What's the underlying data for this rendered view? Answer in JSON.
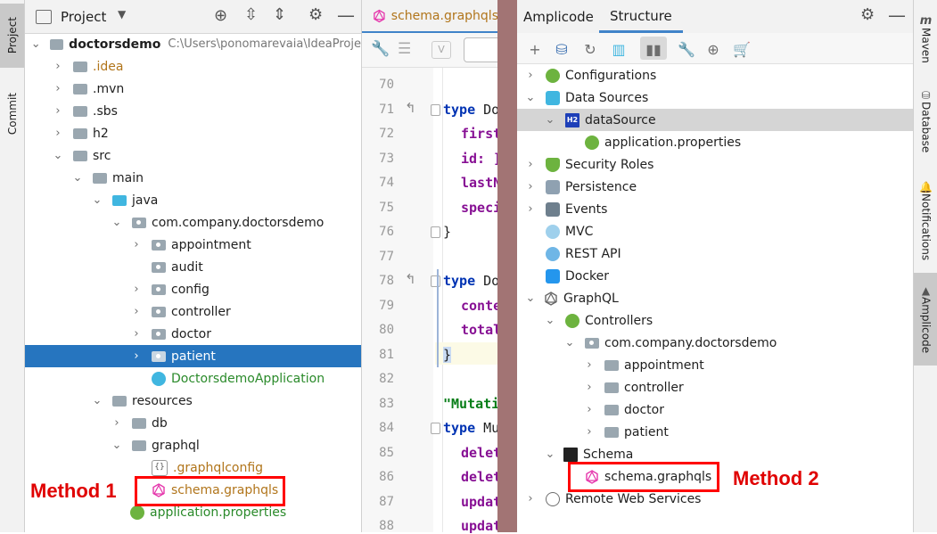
{
  "left_stripe": {
    "project": "Project",
    "commit": "Commit"
  },
  "right_stripe": {
    "maven": "Maven",
    "database": "Database",
    "notifications": "Notifications",
    "amplicode": "Amplicode"
  },
  "project_panel": {
    "title": "Project",
    "root": {
      "name": "doctorsdemo",
      "path": "C:\\Users\\ponomarevaia\\IdeaProje"
    },
    "items": [
      ".idea",
      ".mvn",
      ".sbs",
      "h2",
      "src",
      "main",
      "java",
      "com.company.doctorsdemo",
      "appointment",
      "audit",
      "config",
      "controller",
      "doctor",
      "patient",
      "DoctorsdemoApplication",
      "resources",
      "db",
      "graphql",
      ".graphqlconfig",
      "schema.graphqls",
      "application.properties"
    ]
  },
  "editor": {
    "tab": "schema.graphqls",
    "lines": [
      "70",
      "71",
      "72",
      "73",
      "74",
      "75",
      "76",
      "77",
      "78",
      "79",
      "80",
      "81",
      "82",
      "83",
      "84",
      "85",
      "86",
      "87",
      "88"
    ],
    "code": {
      "l71": "type",
      "l71b": "Do",
      "l72": "first",
      "l73": "id: ]",
      "l74": "lastN",
      "l75": "speci",
      "l76": "}",
      "l78": "type",
      "l78b": "Do",
      "l79": "conte",
      "l80": "total",
      "l81": "}",
      "l83": "\"Mutati",
      "l84": "type",
      "l84b": "Mu",
      "l85": "delet",
      "l86": "delet",
      "l87": "updat",
      "l88": "updat"
    }
  },
  "structure_panel": {
    "tabs": [
      "Amplicode",
      "Structure"
    ],
    "items": [
      "Configurations",
      "Data Sources",
      "dataSource",
      "application.properties",
      "Security Roles",
      "Persistence",
      "Events",
      "MVC",
      "REST API",
      "Docker",
      "GraphQL",
      "Controllers",
      "com.company.doctorsdemo",
      "appointment",
      "controller",
      "doctor",
      "patient",
      "Schema",
      "schema.graphqls",
      "Remote Web Services"
    ],
    "h2_badge": "H2"
  },
  "annotations": {
    "method1": "Method 1",
    "method2": "Method 2"
  },
  "colors": {
    "selection": "#2675bf",
    "highlight": "#ff0000",
    "divider": "#a27474"
  }
}
